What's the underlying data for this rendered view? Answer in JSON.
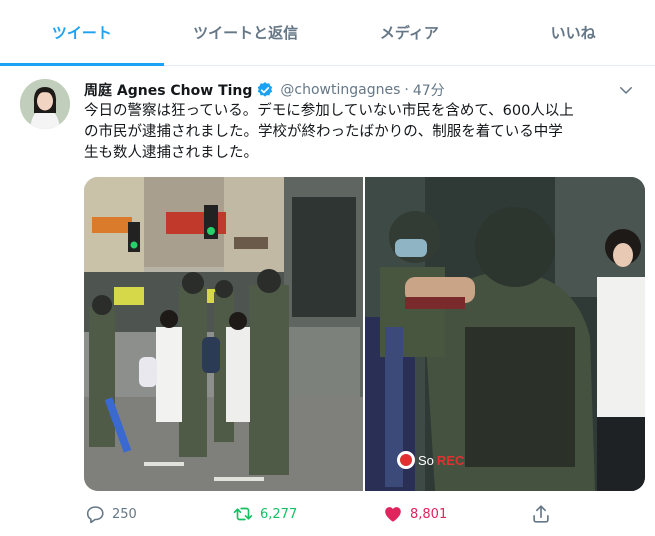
{
  "tabs": [
    {
      "label": "ツイート",
      "active": true
    },
    {
      "label": "ツイートと返信",
      "active": false
    },
    {
      "label": "メディア",
      "active": false
    },
    {
      "label": "いいね",
      "active": false
    }
  ],
  "tweet": {
    "name": "周庭 Agnes Chow Ting",
    "verified": true,
    "handle": "@chowtingagnes",
    "separator": "·",
    "time": "47分",
    "text_lines": [
      "今日の警察は狂っている。デモに参加していない市民を含めて、600人以上",
      "の市民が逮捕されました。学校が終わったばかりの、制服を着ている中学",
      "生も数人逮捕されました。"
    ],
    "media": {
      "photo1_icon": "street-arrest-photo",
      "photo2_icon": "riot-police-closeup-photo",
      "watermark_prefix": "So",
      "watermark_rec": "REC"
    },
    "actions": {
      "reply_count": "250",
      "retweet_count": "6,277",
      "like_count": "8,801"
    }
  },
  "colors": {
    "accent": "#1da1f2",
    "muted": "#657786",
    "retweet": "#17bf63",
    "like": "#e0245e"
  }
}
